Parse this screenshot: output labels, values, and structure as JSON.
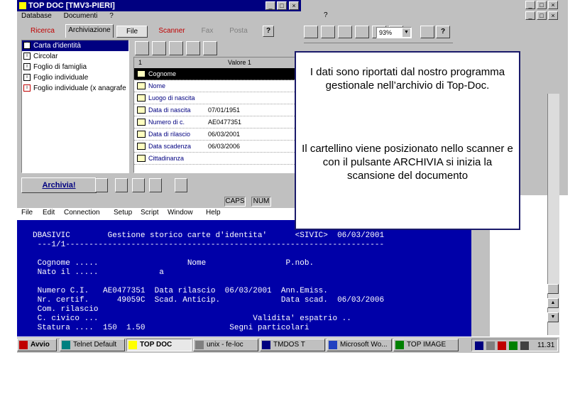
{
  "topdoc": {
    "title": "TOP DOC [TMV3-PIERI]",
    "menu": [
      "Database",
      "Documenti",
      "?"
    ],
    "tabs": [
      "Ricerca",
      "Archiviazione",
      "File",
      "Scanner",
      "Fax",
      "Posta"
    ],
    "tree": [
      "Carta d'identità",
      "Circolar",
      "Foglio di famiglia",
      "Foglio individuale",
      "Foglio individuale (x anagrafe"
    ],
    "grid_header": [
      "1",
      "Valore 1"
    ],
    "grid_rows": [
      {
        "field": "Cognome",
        "value": "",
        "selected": true
      },
      {
        "field": "Nome",
        "value": ""
      },
      {
        "field": "Luogo di nascita",
        "value": ""
      },
      {
        "field": "Data di nascita",
        "value": "07/01/1951"
      },
      {
        "field": "Numero di c.",
        "value": "AE0477351"
      },
      {
        "field": "Data di rilascio",
        "value": "06/03/2001"
      },
      {
        "field": "Data scadenza",
        "value": "06/03/2006"
      },
      {
        "field": "Cittadinanza",
        "value": ""
      }
    ],
    "archive_button": "Archivia!",
    "status": [
      "CAPS",
      "NUM"
    ]
  },
  "word": {
    "menu_tail": [
      "?"
    ],
    "zoom": "93%"
  },
  "callout": {
    "line1": "I dati sono riportati dal nostro programma gestionale nell’archivio di Top-Doc.",
    "line2": "Il cartellino viene posizionato nello scanner e con il pulsante ARCHIVIA si inizia la scansione del documento"
  },
  "terminal": {
    "menu": [
      "File",
      "Edit",
      "Connection",
      "Setup",
      "Script",
      "Window",
      "Help"
    ],
    "rows": [
      "DBASIVIC        Gestione storico carte d'identita'      <SIVIC>  06/03/2001",
      " ---1/1--------------------------------------------------------------------",
      "",
      " Cognome .....                   Nome                 P.nob.",
      " Nato il .....             a",
      "",
      " Numero C.I.   AE0477351  Data rilascio  06/03/2001  Ann.Emiss.",
      " Nr. certif.      49059C  Scad. Anticip.             Data scad.  06/03/2006",
      " Com. rilascio",
      " C. civico ...                                 Validita' espatrio ..",
      " Statura ....  150  1.50                  Segni particolari"
    ]
  },
  "taskbar": {
    "items": [
      "Avvio",
      "Telnet Default",
      "TOP DOC",
      "unix - fe-loc",
      "TMDOS T",
      "Microsoft Wo...",
      "TOP IMAGE"
    ],
    "clock": "11.31"
  },
  "colors": {
    "title_blue": "#000080",
    "terminal_blue": "#0000a8",
    "callout_border": "#1a1a6a"
  }
}
